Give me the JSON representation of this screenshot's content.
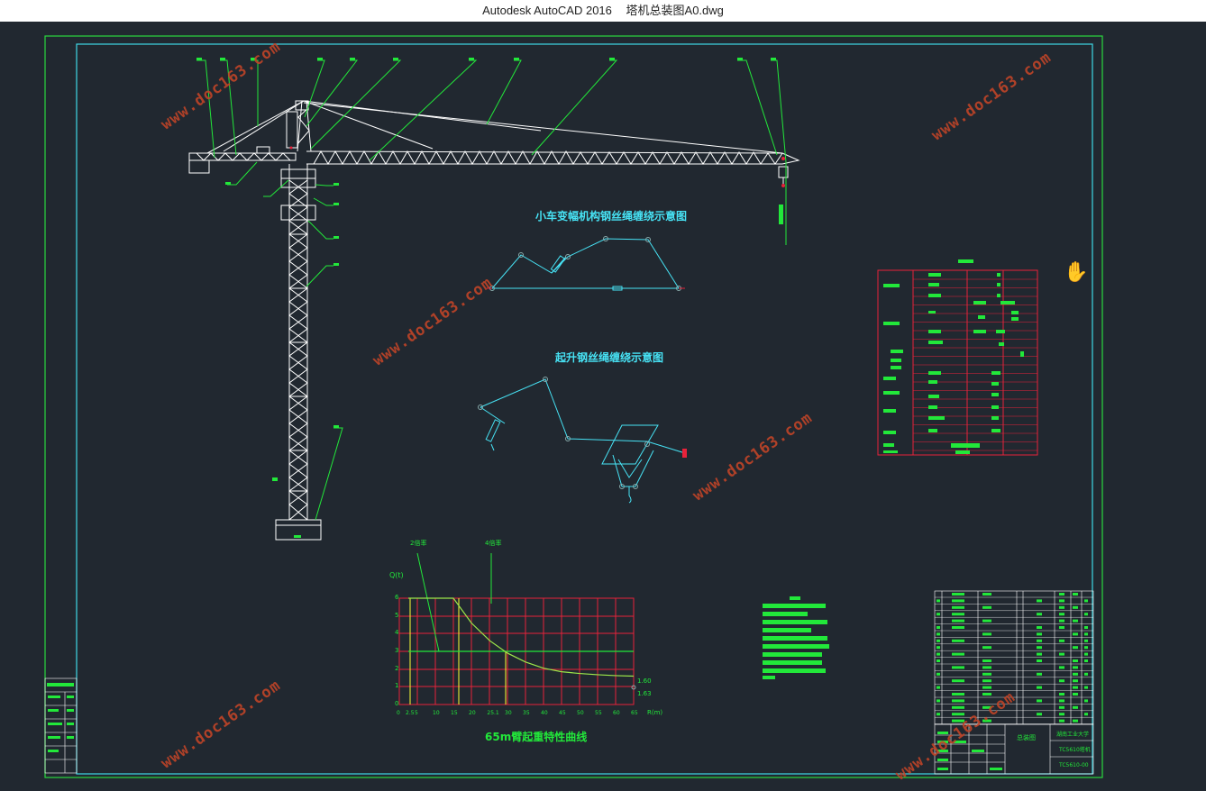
{
  "window": {
    "app_name": "Autodesk AutoCAD 2016",
    "file_name": "塔机总装图A0.dwg"
  },
  "drawing": {
    "trolley_rope_title": "小车变幅机构钢丝绳缠绕示意图",
    "hoist_rope_title": "起升钢丝绳缠绕示意图",
    "load_curve": {
      "title": "65m臂起重特性曲线",
      "y_axis_label": "Q(t)",
      "x_axis_label": "R(m)",
      "curve_label_a": "2倍率",
      "curve_label_b": "4倍率",
      "y_ticks": [
        "0",
        "1",
        "2",
        "3",
        "4",
        "5",
        "6"
      ],
      "x_ticks": [
        "0",
        "2.5",
        "5",
        "10",
        "15",
        "20",
        "25.1",
        "30",
        "35",
        "40",
        "45",
        "50",
        "55",
        "60",
        "65"
      ],
      "end_value_top": "1.60",
      "end_value_bottom": "1.63"
    }
  },
  "chart_data": {
    "type": "line",
    "title": "65m臂起重特性曲线",
    "xlabel": "R(m)",
    "ylabel": "Q(t)",
    "xlim": [
      0,
      65
    ],
    "ylim": [
      0,
      6
    ],
    "grid": true,
    "x": [
      2.5,
      15,
      20,
      25.1,
      30,
      35,
      40,
      45,
      50,
      55,
      60,
      65
    ],
    "series": [
      {
        "name": "2倍率",
        "values": [
          3,
          3,
          3,
          3,
          3,
          3,
          3,
          3,
          3,
          3,
          3,
          3
        ]
      },
      {
        "name": "4倍率",
        "values": [
          6,
          6,
          4.6,
          3.6,
          2.9,
          2.4,
          2.05,
          1.85,
          1.75,
          1.68,
          1.63,
          1.6
        ]
      }
    ]
  },
  "title_block": {
    "drawing_name": "总装图",
    "school": "湖南工业大学",
    "model": "TC5610塔机",
    "drawing_number": "TC5610-00"
  },
  "colors": {
    "background": "#212830",
    "border_outer": "#2bd93f",
    "border_inner": "#3fd9e6",
    "crane": "#ffffff",
    "leader": "#22e83a",
    "table": "#e8223a",
    "text_cyan": "#47e3f5",
    "watermark": "#c04428"
  },
  "watermark_text": "www.doc163.com",
  "cursor_icon": "hand-pan-icon"
}
